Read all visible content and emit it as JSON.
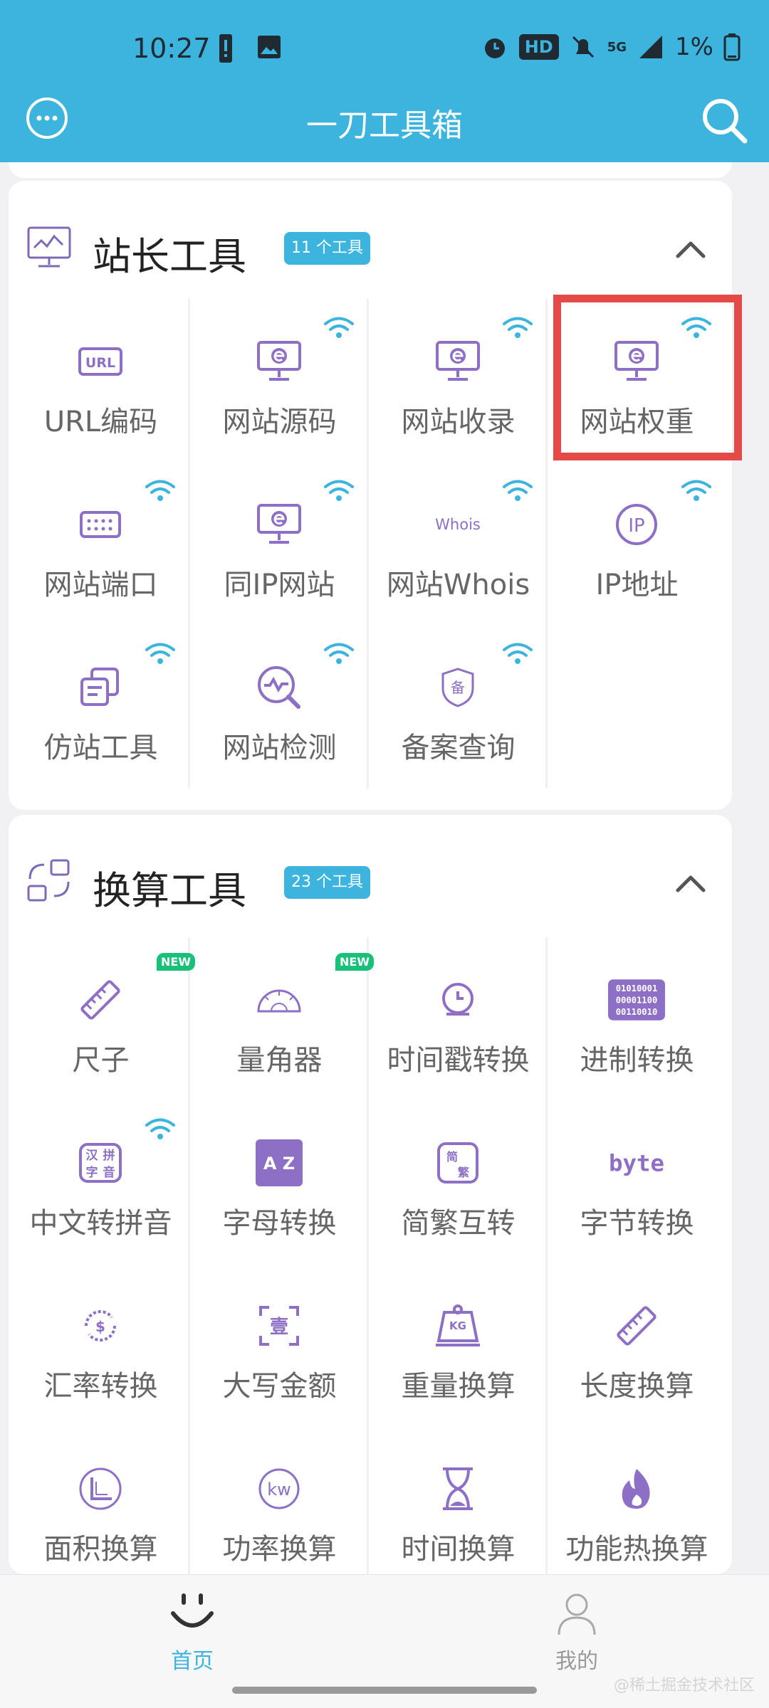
{
  "status_bar": {
    "time": "10:27",
    "hd": "HD",
    "network": "5G",
    "battery": "1%"
  },
  "app_bar": {
    "title": "一刀工具箱"
  },
  "sections": [
    {
      "title": "站长工具",
      "badge": "11 个工具",
      "tools": [
        {
          "label": "URL编码",
          "icon": "url-icon",
          "wifi": false
        },
        {
          "label": "网站源码",
          "icon": "monitor-e-icon",
          "wifi": true
        },
        {
          "label": "网站收录",
          "icon": "monitor-e-icon",
          "wifi": true
        },
        {
          "label": "网站权重",
          "icon": "monitor-e-icon",
          "wifi": true
        },
        {
          "label": "网站端口",
          "icon": "keyboard-icon",
          "wifi": true
        },
        {
          "label": "同IP网站",
          "icon": "monitor-e-icon",
          "wifi": true
        },
        {
          "label": "网站Whois",
          "icon": "whois-icon",
          "wifi": true,
          "icon_text": "Whois"
        },
        {
          "label": "IP地址",
          "icon": "ip-icon",
          "wifi": true,
          "icon_text": "IP"
        },
        {
          "label": "仿站工具",
          "icon": "copy-icon",
          "wifi": true
        },
        {
          "label": "网站检测",
          "icon": "scan-icon",
          "wifi": true
        },
        {
          "label": "备案查询",
          "icon": "shield-icon",
          "wifi": true,
          "icon_text": "备"
        }
      ]
    },
    {
      "title": "换算工具",
      "badge": "23 个工具",
      "tools": [
        {
          "label": "尺子",
          "icon": "ruler-icon",
          "new": "NEW"
        },
        {
          "label": "量角器",
          "icon": "protractor-icon",
          "new": "NEW"
        },
        {
          "label": "时间戳转换",
          "icon": "clock-icon"
        },
        {
          "label": "进制转换",
          "icon": "binary-icon",
          "icon_text": "01010001"
        },
        {
          "label": "中文转拼音",
          "icon": "pinyin-icon",
          "wifi": true,
          "icon_text": "汉拼字音"
        },
        {
          "label": "字母转换",
          "icon": "az-icon",
          "icon_text": "AZ"
        },
        {
          "label": "简繁互转",
          "icon": "simplified-traditional-icon",
          "icon_text": "简繁"
        },
        {
          "label": "字节转换",
          "icon": "byte-icon",
          "icon_text": "byte"
        },
        {
          "label": "汇率转换",
          "icon": "currency-icon",
          "icon_text": "$"
        },
        {
          "label": "大写金额",
          "icon": "capital-amount-icon",
          "icon_text": "壹"
        },
        {
          "label": "重量换算",
          "icon": "weight-icon",
          "icon_text": "KG"
        },
        {
          "label": "长度换算",
          "icon": "ruler-icon"
        },
        {
          "label": "面积换算",
          "icon": "area-icon"
        },
        {
          "label": "功率换算",
          "icon": "power-icon",
          "icon_text": "kw"
        },
        {
          "label": "时间换算",
          "icon": "hourglass-icon"
        },
        {
          "label": "功能热换算",
          "icon": "fire-icon"
        }
      ]
    }
  ],
  "bottom_nav": {
    "items": [
      {
        "label": "首页",
        "active": true
      },
      {
        "label": "我的",
        "active": false
      }
    ]
  },
  "watermark": "@稀土掘金技术社区",
  "colors": {
    "primary": "#3cb4de",
    "icon_purple": "#8e6fc6",
    "highlight": "#e44a47",
    "new_badge": "#19c07a"
  }
}
